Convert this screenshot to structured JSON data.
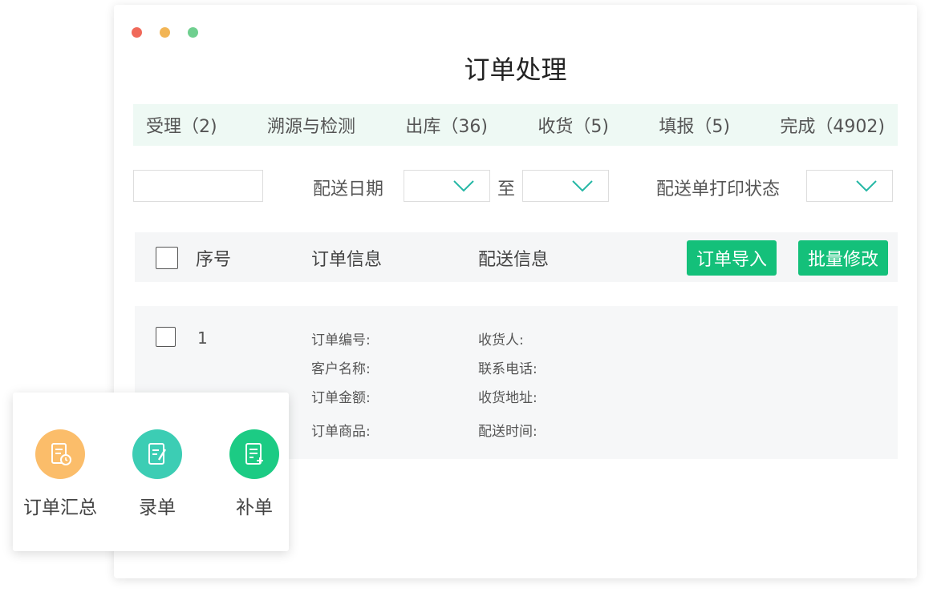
{
  "window": {
    "title": "订单处理",
    "dot_colors": [
      "#f0695a",
      "#f2b555",
      "#6fcf8f"
    ]
  },
  "tabs": [
    {
      "label": "受理（2)"
    },
    {
      "label": "溯源与检测"
    },
    {
      "label": "出库（36)"
    },
    {
      "label": "收货（5)"
    },
    {
      "label": "填报（5)"
    },
    {
      "label": "完成（4902)"
    }
  ],
  "filters": {
    "search_value": "",
    "delivery_date_label": "配送日期",
    "date_from_value": "",
    "to_label": "至",
    "date_to_value": "",
    "print_status_label": "配送单打印状态",
    "print_status_value": ""
  },
  "table": {
    "headers": {
      "index": "序号",
      "order_info": "订单信息",
      "delivery_info": "配送信息"
    },
    "buttons": {
      "import": "订单导入",
      "batch_edit": "批量修改"
    },
    "rows": [
      {
        "index": "1",
        "order_fields": [
          "订单编号:",
          "客户名称:",
          "订单金额:",
          "订单商品:"
        ],
        "delivery_fields": [
          "收货人:",
          "联系电话:",
          "收货地址:",
          "配送时间:"
        ]
      }
    ]
  },
  "quick_actions": [
    {
      "label": "订单汇总",
      "icon": "order-summary-icon",
      "color": "#fbbd6a"
    },
    {
      "label": "录单",
      "icon": "edit-document-icon",
      "color": "#3ccdb4"
    },
    {
      "label": "补单",
      "icon": "add-document-icon",
      "color": "#1ccb84"
    }
  ],
  "colors": {
    "accent_green": "#14c07a",
    "tab_bar_bg": "#eef9f4"
  }
}
